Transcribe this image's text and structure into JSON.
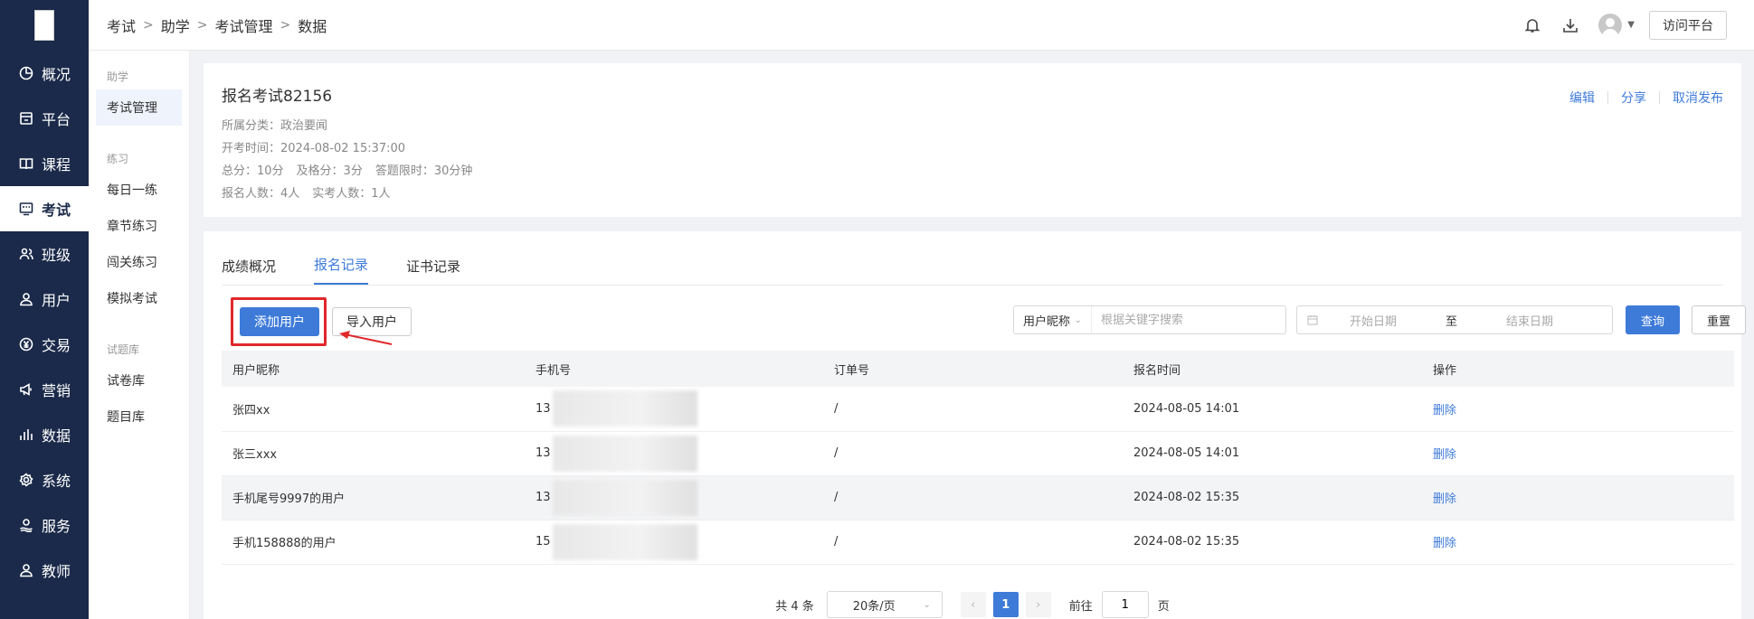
{
  "sidebar": {
    "items": [
      {
        "label": "概况",
        "icon": "pie-chart-icon"
      },
      {
        "label": "平台",
        "icon": "store-icon"
      },
      {
        "label": "课程",
        "icon": "book-icon"
      },
      {
        "label": "考试",
        "icon": "exam-icon",
        "active": true
      },
      {
        "label": "班级",
        "icon": "users-icon"
      },
      {
        "label": "用户",
        "icon": "user-icon"
      },
      {
        "label": "交易",
        "icon": "yen-icon"
      },
      {
        "label": "营销",
        "icon": "megaphone-icon"
      },
      {
        "label": "数据",
        "icon": "bar-chart-icon"
      },
      {
        "label": "系统",
        "icon": "gear-icon"
      },
      {
        "label": "服务",
        "icon": "service-icon"
      },
      {
        "label": "教师",
        "icon": "teacher-icon"
      }
    ]
  },
  "header": {
    "breadcrumb": [
      "考试",
      "助学",
      "考试管理",
      "数据"
    ],
    "visit_label": "访问平台"
  },
  "subnav": {
    "groups": [
      {
        "title": "助学",
        "items": [
          "考试管理"
        ]
      },
      {
        "title": "练习",
        "items": [
          "每日一练",
          "章节练习",
          "闯关练习",
          "模拟考试"
        ]
      },
      {
        "title": "试题库",
        "items": [
          "试卷库",
          "题目库"
        ]
      }
    ]
  },
  "exam": {
    "title": "报名考试82156",
    "category": "所属分类：政治要闻",
    "start_time": "开考时间：2024-08-02 15:37:00",
    "total_score": "总分：10分",
    "pass_score": "及格分：3分",
    "time_limit": "答题限时：30分钟",
    "registered": "报名人数：4人",
    "actual": "实考人数：1人",
    "actions": {
      "edit": "编辑",
      "share": "分享",
      "unpublish": "取消发布"
    }
  },
  "tabs": [
    "成绩概况",
    "报名记录",
    "证书记录"
  ],
  "active_tab": 1,
  "toolbar": {
    "add_user": "添加用户",
    "import_user": "导入用户",
    "search_field": "用户昵称",
    "search_placeholder": "根据关键字搜索",
    "start_date": "开始日期",
    "to": "至",
    "end_date": "结束日期",
    "query": "查询",
    "reset": "重置"
  },
  "table": {
    "columns": [
      "用户昵称",
      "手机号",
      "订单号",
      "报名时间",
      "操作"
    ],
    "rows": [
      {
        "nickname": "张四xx",
        "phone": "13",
        "order": "/",
        "time": "2024-08-05 14:01",
        "action": "删除"
      },
      {
        "nickname": "张三xxx",
        "phone": "13",
        "order": "/",
        "time": "2024-08-05 14:01",
        "action": "删除"
      },
      {
        "nickname": "手机尾号9997的用户",
        "phone": "13",
        "order": "/",
        "time": "2024-08-02 15:35",
        "action": "删除"
      },
      {
        "nickname": "手机158888的用户",
        "phone": "15",
        "order": "/",
        "time": "2024-08-02 15:35",
        "action": "删除"
      }
    ]
  },
  "pagination": {
    "total": "共 4 条",
    "page_size": "20条/页",
    "current": "1",
    "goto_label": "前往",
    "goto_value": "1",
    "page_suffix": "页"
  },
  "colors": {
    "sidebar": "#1b2a4a",
    "accent": "#3e7bd9",
    "highlight": "#e0282b"
  }
}
